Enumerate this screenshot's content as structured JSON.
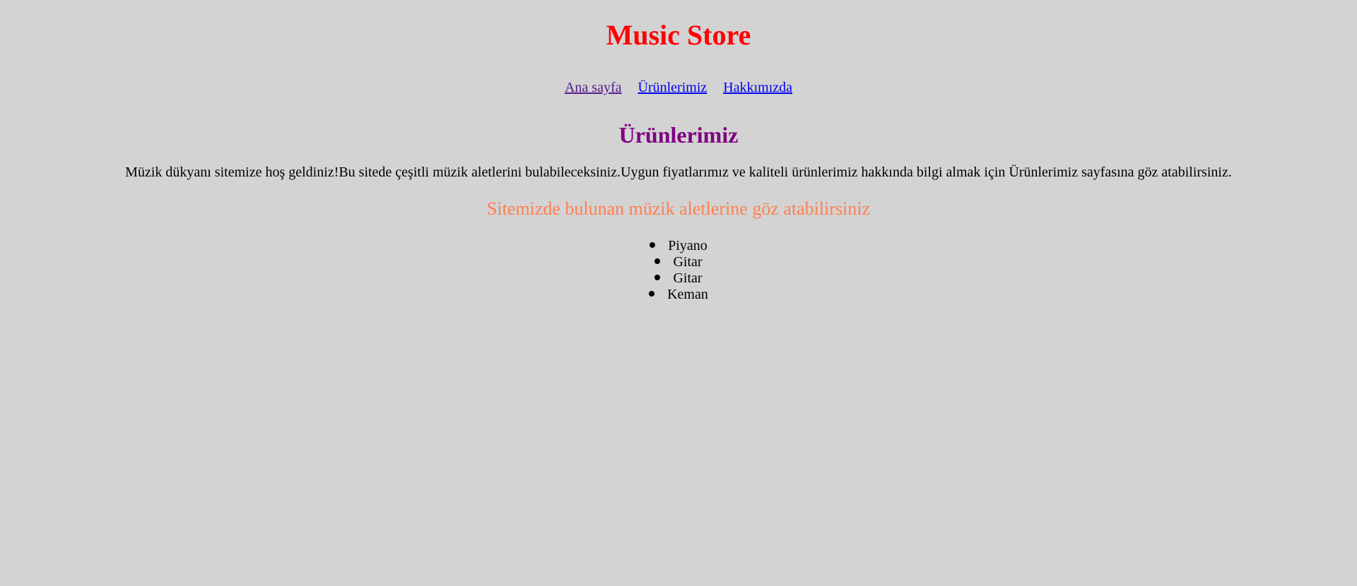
{
  "site": {
    "title": "Music Store",
    "title_color": "#ff0000"
  },
  "nav": {
    "items": [
      {
        "label": "Ana sayfa",
        "color": "#551a8b"
      },
      {
        "label": "Ürünlerimiz",
        "color": "#0000ee"
      },
      {
        "label": "Hakkımızda",
        "color": "#0000ee"
      }
    ]
  },
  "main": {
    "heading": "Ürünlerimiz",
    "heading_color": "#800080",
    "intro": "Müzik dükyanı sitemize hoş geldiniz!Bu sitede çeşitli müzik aletlerini bulabileceksiniz.Uygun fiyatlarımız ve kaliteli ürünlerimiz hakkında bilgi almak için Ürünlerimiz sayfasına göz atabilirsiniz.",
    "subheading": "Sitemizde bulunan müzik aletlerine göz atabilirsiniz",
    "subheading_color": "#ff7f50",
    "instruments": [
      "Piyano",
      "Gitar",
      "Gitar",
      "Keman"
    ]
  }
}
